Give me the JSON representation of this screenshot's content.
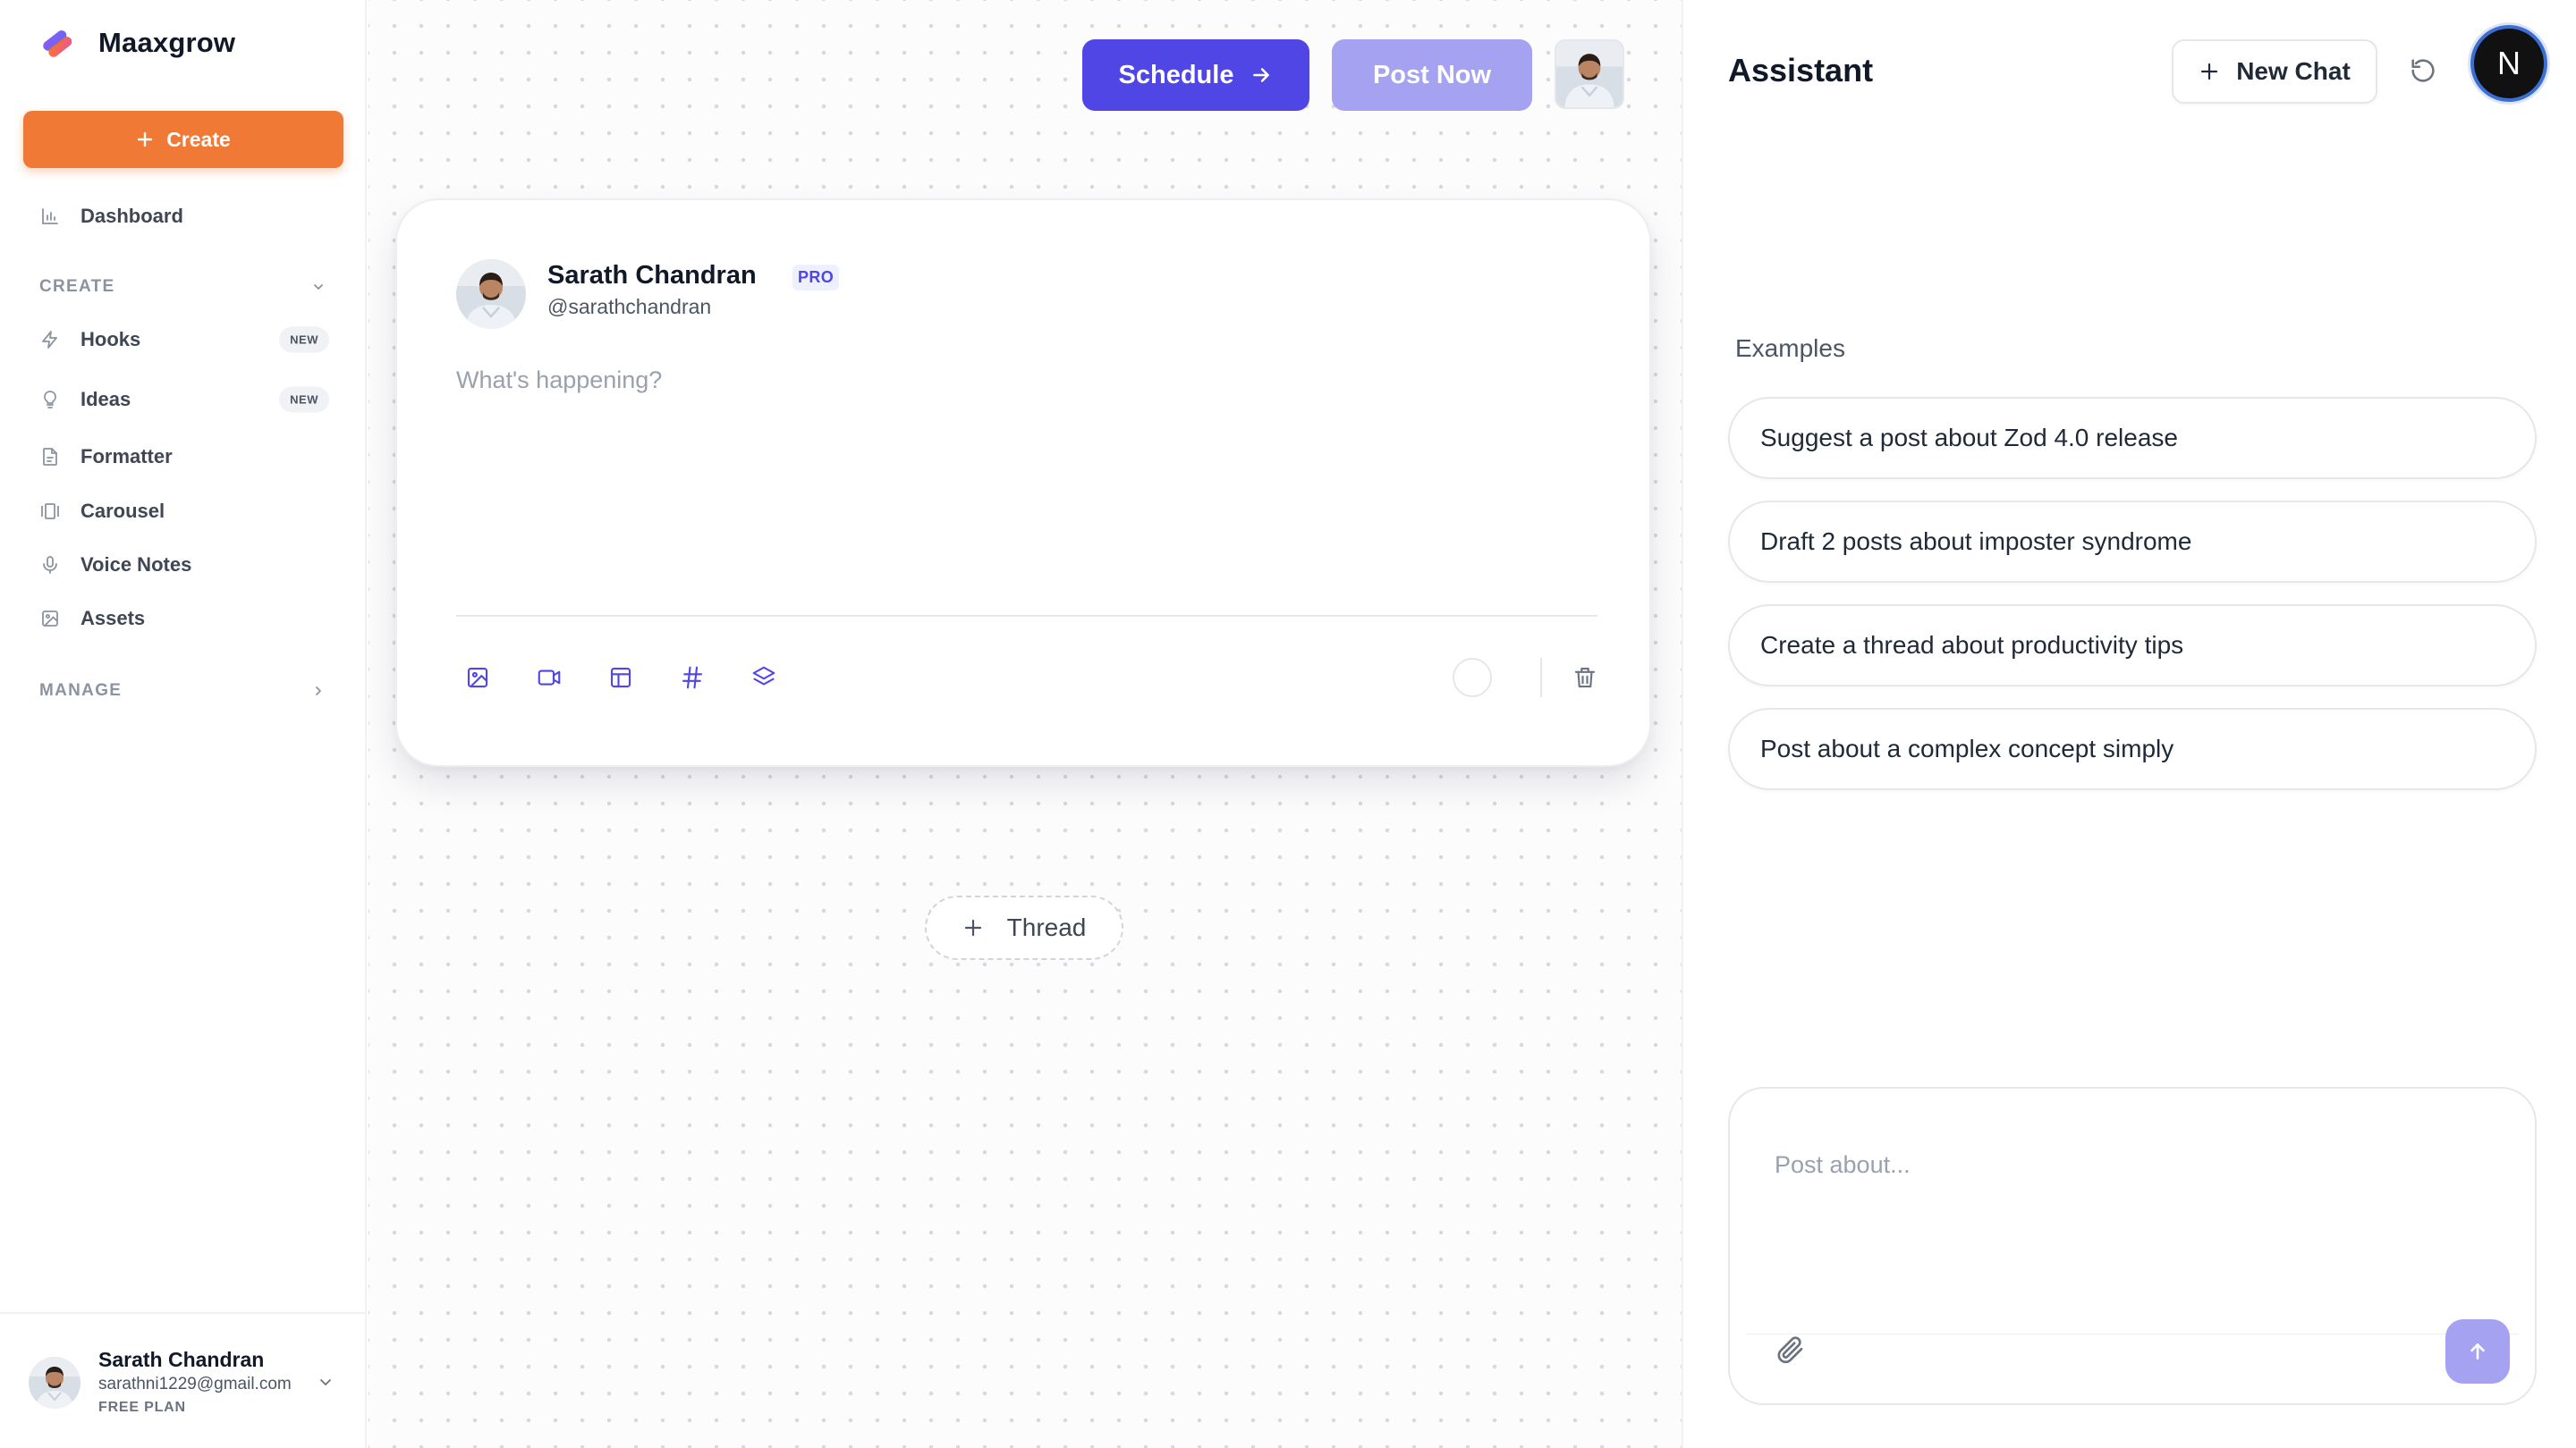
{
  "brand": {
    "name": "Maaxgrow"
  },
  "sidebar": {
    "create_label": "Create",
    "dashboard_label": "Dashboard",
    "create_section_label": "CREATE",
    "create_items": [
      {
        "label": "Hooks",
        "icon": "zap-icon",
        "badge": "NEW"
      },
      {
        "label": "Ideas",
        "icon": "lightbulb-icon",
        "badge": "NEW"
      },
      {
        "label": "Formatter",
        "icon": "file-text-icon"
      },
      {
        "label": "Carousel",
        "icon": "carousel-icon"
      },
      {
        "label": "Voice Notes",
        "icon": "microphone-icon"
      },
      {
        "label": "Assets",
        "icon": "image-icon"
      }
    ],
    "manage_section_label": "MANAGE"
  },
  "user": {
    "name": "Sarath Chandran",
    "email": "sarathni1229@gmail.com",
    "plan": "FREE PLAN"
  },
  "topbar": {
    "schedule_label": "Schedule",
    "post_now_label": "Post Now"
  },
  "composer": {
    "name": "Sarath Chandran",
    "pro_badge": "PRO",
    "handle": "@sarathchandran",
    "placeholder": "What's happening?",
    "tools": [
      "image-icon",
      "video-icon",
      "template-icon",
      "hashtag-icon",
      "layers-icon"
    ]
  },
  "thread_label": "Thread",
  "assistant": {
    "title": "Assistant",
    "new_chat_label": "New Chat",
    "avatar_letter": "N",
    "examples_label": "Examples",
    "examples": [
      "Suggest a post about Zod 4.0 release",
      "Draft 2 posts about imposter syndrome",
      "Create a thread about productivity tips",
      "Post about a complex concept simply"
    ],
    "input_placeholder": "Post about..."
  },
  "colors": {
    "accent": "#4f46e5",
    "accent_light": "#a5a2f2",
    "create_orange": "#f07a35"
  }
}
